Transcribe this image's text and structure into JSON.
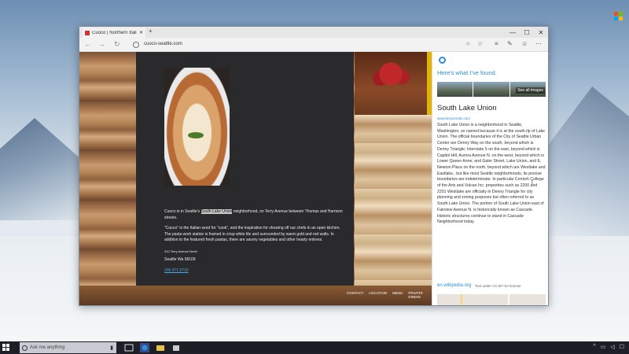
{
  "browser": {
    "tab_title": "Cuoco | Northern Italian...",
    "url": "cuoco-seattle.com"
  },
  "page": {
    "paragraph1_before": "Cuoco is in Seattle's ",
    "paragraph1_highlight": "South Lake Union",
    "paragraph1_after": " neighborhood, on Terry Avenue between Thomas and Harrison streets.",
    "paragraph2": "\"Cuoco\" is the Italian word for \"cook\", and the inspiration for showing off our chefs in an open kitchen.  The pasta work station is framed in crisp white tile and surrounded by warm gold and red walls.  In addition to the featured fresh pastas, there are savory vegetables and other hearty entrees.",
    "address": "310 Terry Avenue North",
    "city": "Seattle Wa 98109",
    "phone": "206.971.0710",
    "footer_nav": [
      "CONTACT",
      "LOCATION",
      "MENU",
      "PRIVATE DINING"
    ]
  },
  "cortana": {
    "heading": "Here's what I've found.",
    "see_all": "See all images",
    "title": "South Lake Union",
    "source": "www.bizjournals.com",
    "description": "South Lake Union is a neighborhood in Seattle, Washington, so named because it is at the south tip of Lake Union. The official boundaries of the City of Seattle Urban Center are Denny Way on the south, beyond which is Denny Triangle; Interstate 5 on the east, beyond which is Capitol Hill; Aurora Avenue N. on the west, beyond which is Lower Queen Anne; and Galer Street, Lake Union, and E. Newton Place on the north, beyond which are Westlake and Eastlake,. but like most Seattle neighborhoods, its precise boundaries are indeterminate. In particular Cornish College of the Arts and Vulcan Inc. properties such as 2200 and 2201 Westlake are officially in Denny Triangle for city planning and zoning purposes but often referred to as South Lake Union. The portion of South Lake Union east of Fairview Avenue N. is historically known as Cascade. Historic structures continue to stand in Cascade Neighborhood today.",
    "wiki_link": "en.wikipedia.org",
    "license": "Text under CC-BY-SA license"
  },
  "taskbar": {
    "search_placeholder": "Ask me anything"
  },
  "colors": {
    "accent": "#2b8fd9",
    "dark_panel": "#2a2a2c",
    "taskbar": "#1c1f26"
  }
}
